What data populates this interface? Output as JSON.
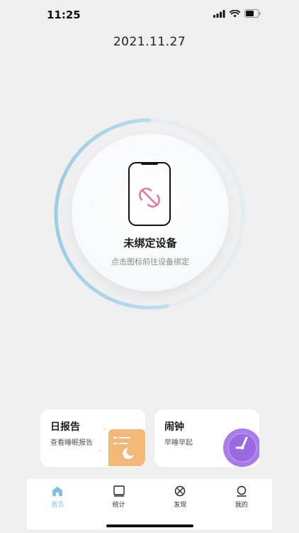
{
  "status": {
    "time": "11:25"
  },
  "date": "2021.11.27",
  "device": {
    "title": "未绑定设备",
    "subtitle": "点击图标前往设备绑定",
    "ring_progress": 0.53
  },
  "cards": [
    {
      "title": "日报告",
      "subtitle": "查看睡眠报告"
    },
    {
      "title": "闹钟",
      "subtitle": "早睡早起"
    }
  ],
  "tabs": [
    {
      "label": "首页",
      "icon": "home-icon",
      "active": true
    },
    {
      "label": "统计",
      "icon": "stats-icon",
      "active": false
    },
    {
      "label": "发现",
      "icon": "discover-icon",
      "active": false
    },
    {
      "label": "我的",
      "icon": "profile-icon",
      "active": false
    }
  ],
  "colors": {
    "accent": "#7fc0e4",
    "ring": "#a6d3ea",
    "unlink": "#e0749a",
    "report": "#f3b877",
    "alarm": "#a77be8"
  }
}
